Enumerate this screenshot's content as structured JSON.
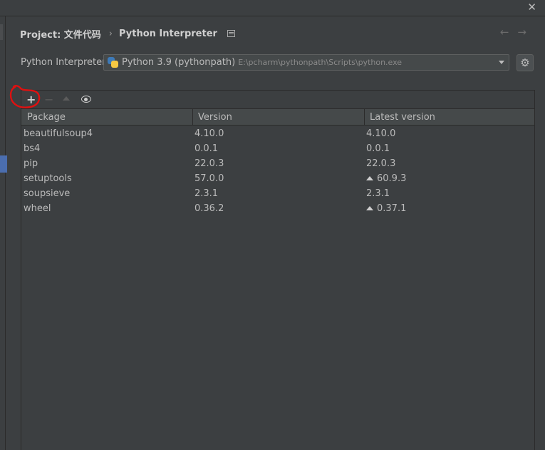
{
  "breadcrumb": {
    "project": "Project: 文件代码",
    "separator": "›",
    "page": "Python Interpreter"
  },
  "icons": {
    "close": "close-icon",
    "back": "arrow-left-icon",
    "forward": "arrow-right-icon",
    "settings": "gear-icon",
    "python": "python-icon",
    "add": "plus-icon",
    "remove": "minus-icon",
    "upgrade": "triangle-up-icon",
    "show": "eye-icon"
  },
  "interpreter": {
    "label": "Python Interpreter:",
    "name": "Python 3.9 (pythonpath)",
    "path": "E:\\pcharm\\pythonpath\\Scripts\\python.exe"
  },
  "table": {
    "headers": [
      "Package",
      "Version",
      "Latest version"
    ],
    "rows": [
      {
        "package": "beautifulsoup4",
        "version": "4.10.0",
        "latest": "4.10.0",
        "upgrade": false
      },
      {
        "package": "bs4",
        "version": "0.0.1",
        "latest": "0.0.1",
        "upgrade": false
      },
      {
        "package": "pip",
        "version": "22.0.3",
        "latest": "22.0.3",
        "upgrade": false
      },
      {
        "package": "setuptools",
        "version": "57.0.0",
        "latest": "60.9.3",
        "upgrade": true
      },
      {
        "package": "soupsieve",
        "version": "2.3.1",
        "latest": "2.3.1",
        "upgrade": false
      },
      {
        "package": "wheel",
        "version": "0.36.2",
        "latest": "0.37.1",
        "upgrade": true
      }
    ]
  },
  "colors": {
    "background": "#3c3f41",
    "header": "#45494a",
    "text": "#bbbbbb",
    "accent": "#4b6eaf",
    "annotation": "#e01010"
  }
}
